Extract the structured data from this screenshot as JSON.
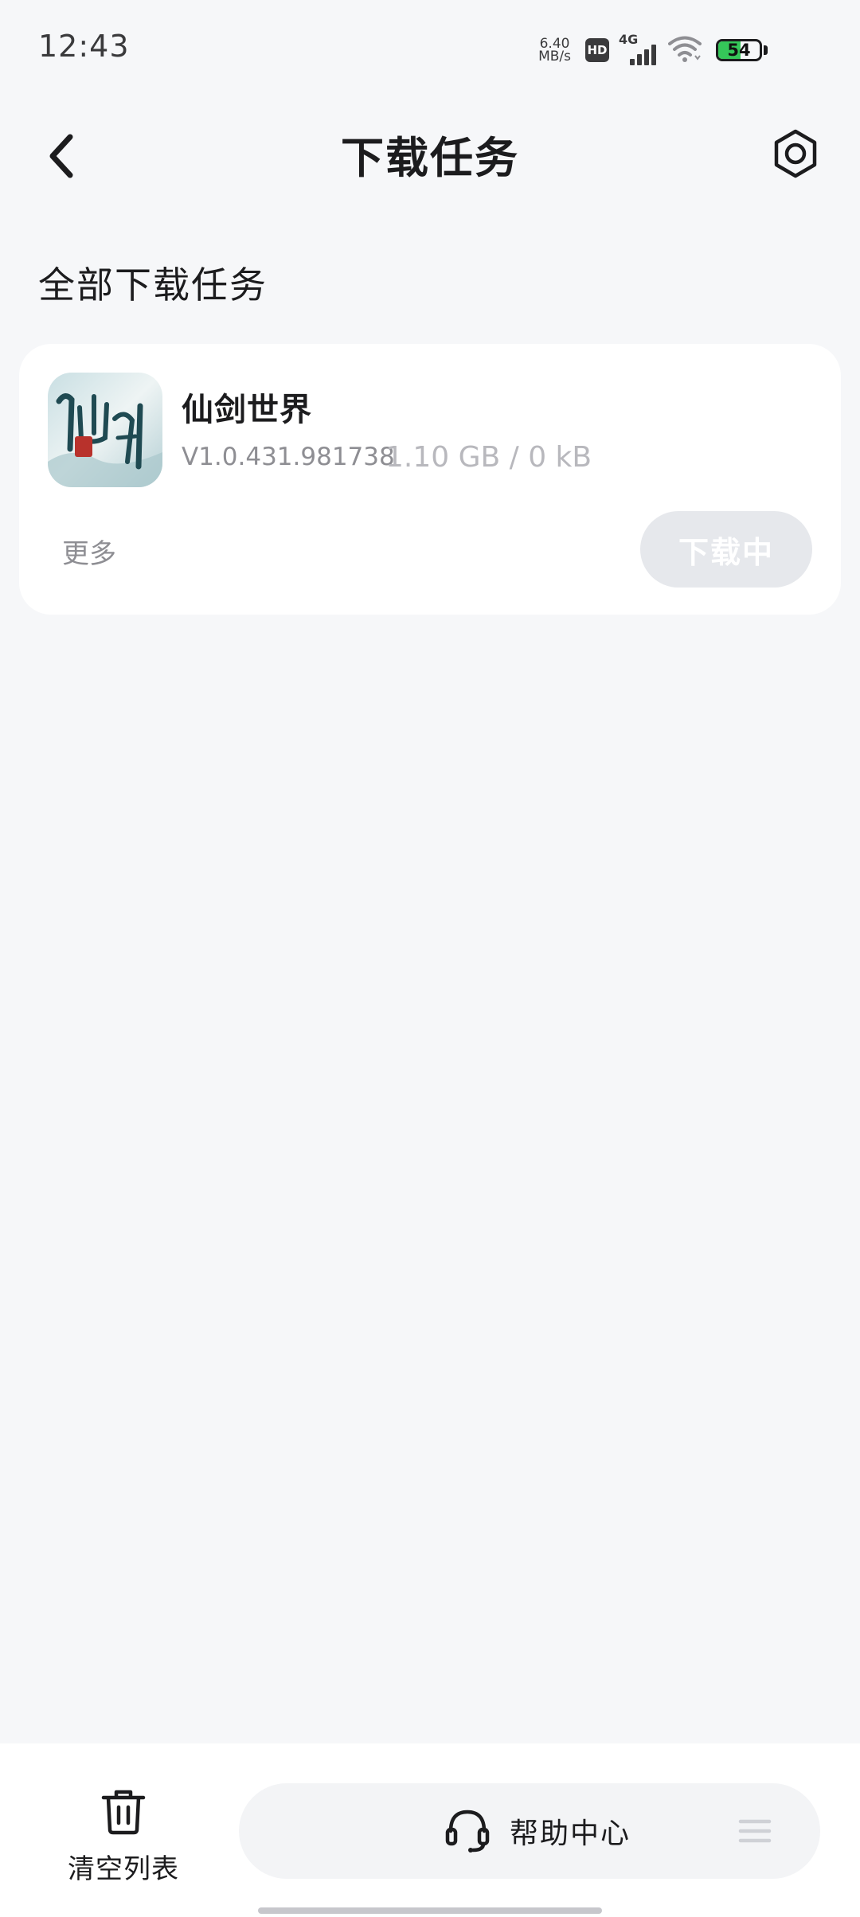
{
  "status_bar": {
    "time": "12:43",
    "net_speed_value": "6.40",
    "net_speed_unit": "MB/s",
    "hd": "HD",
    "signal": "4G",
    "battery_level": "54",
    "battery_fraction": 0.54,
    "battery_color": "#35c759"
  },
  "header": {
    "title": "下载任务",
    "back_icon": "chevron-left-icon",
    "settings_icon": "hexagon-settings-icon"
  },
  "section": {
    "title": "全部下载任务"
  },
  "tasks": [
    {
      "name": "仙剑世界",
      "version": "V1.0.431.981738",
      "size": "1.10 GB / 0 kB",
      "more_label": "更多",
      "status_label": "下载中"
    }
  ],
  "bottom_bar": {
    "clear_label": "清空列表",
    "help_label": "帮助中心",
    "clear_icon": "trash-icon",
    "help_icon": "headset-icon",
    "menu_icon": "menu-lines-icon"
  }
}
